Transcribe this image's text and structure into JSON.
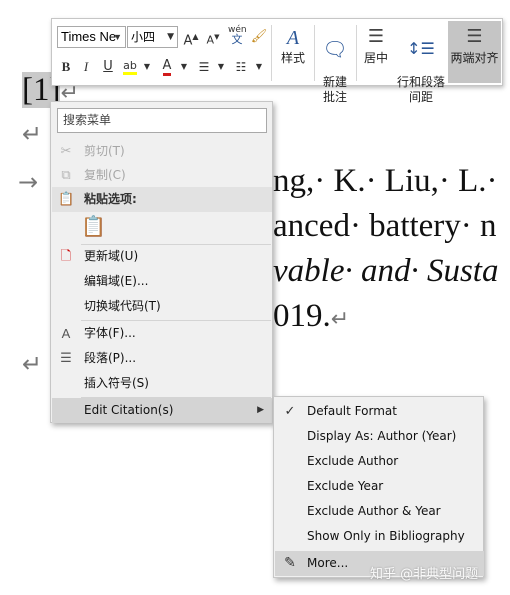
{
  "document": {
    "ref_label": "[1]",
    "line1": "ng,· K.· Liu,· L.·",
    "line2": "anced· battery· n",
    "line3": "vable· and· Susta",
    "line4": "019.",
    "para_mark": "↵",
    "tab_arrow": "→"
  },
  "toolbar": {
    "font_name": "Times Ne",
    "font_size": "小四",
    "styles_label": "样式",
    "new_comment_label": "新建\n批注",
    "center_label": "居中",
    "line_spacing_label": "行和段落\n间距",
    "distributed_label": "两端对齐",
    "bold_label": "B",
    "italic_label": "I",
    "underline_label": "U",
    "grow_font_label": "A",
    "shrink_font_label": "A",
    "phonetic_label": "wén",
    "highlight_label": "ab",
    "font_color_label": "A"
  },
  "context_menu": {
    "search_placeholder": "搜索菜单",
    "items": [
      {
        "label": "剪切(T)",
        "icon": "cut-icon",
        "disabled": true
      },
      {
        "label": "复制(C)",
        "icon": "copy-icon",
        "disabled": true
      },
      {
        "label": "粘贴选项:",
        "icon": "paste-icon",
        "header": true
      },
      {
        "label": "更新域(U)",
        "icon": "update-field-icon"
      },
      {
        "label": "编辑域(E)...",
        "icon": ""
      },
      {
        "label": "切换域代码(T)",
        "icon": ""
      },
      {
        "label": "字体(F)...",
        "icon": "font-icon"
      },
      {
        "label": "段落(P)...",
        "icon": "paragraph-icon"
      },
      {
        "label": "插入符号(S)",
        "icon": ""
      },
      {
        "label": "Edit Citation(s)",
        "icon": "",
        "submenu": true
      }
    ]
  },
  "submenu": {
    "items": [
      {
        "label": "Default Format",
        "checked": true
      },
      {
        "label": "Display As: Author (Year)",
        "checked": false
      },
      {
        "label": "Exclude Author",
        "checked": false
      },
      {
        "label": "Exclude Year",
        "checked": false
      },
      {
        "label": "Exclude Author & Year",
        "checked": false
      },
      {
        "label": "Show Only in Bibliography",
        "checked": false
      },
      {
        "label": "More...",
        "checked": false
      }
    ]
  },
  "watermark": "知乎 @非典型问题",
  "colors": {
    "menu_bg": "#f0f0f0",
    "hover_bg": "#d4d4d4",
    "selection": "#c9c9c9",
    "font_color_red": "#d11b1b",
    "highlight_yellow": "#ffff00",
    "icon_blue": "#2b5797"
  }
}
